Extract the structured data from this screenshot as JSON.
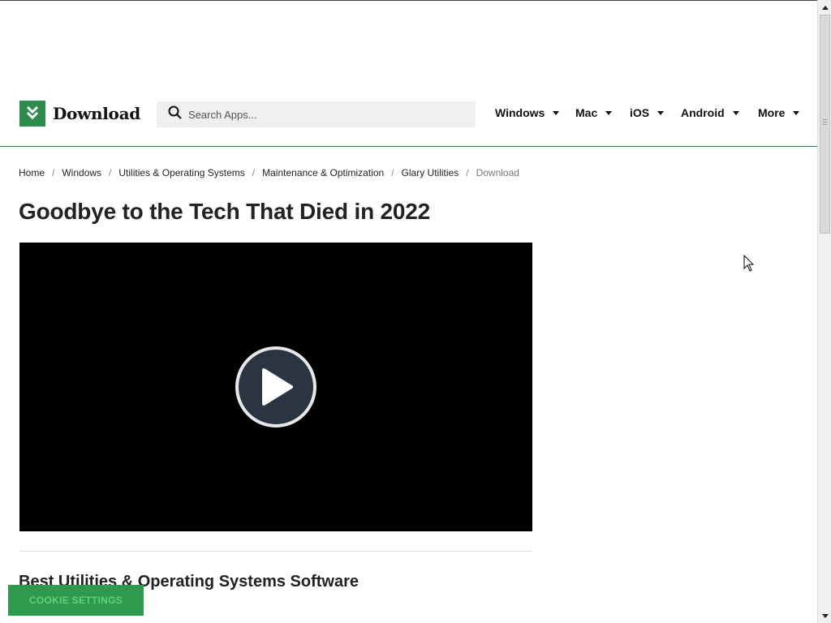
{
  "header": {
    "logo_text": "Download",
    "search_placeholder": "Search Apps...",
    "nav": [
      "Windows",
      "Mac",
      "iOS",
      "Android",
      "More"
    ]
  },
  "breadcrumb": {
    "items": [
      "Home",
      "Windows",
      "Utilities & Operating Systems",
      "Maintenance & Optimization",
      "Glary Utilities"
    ],
    "current": "Download"
  },
  "page_title": "Goodbye to the Tech That Died in 2022",
  "section_title": "Best Utilities & Operating Systems Software",
  "cookie_button": "COOKIE SETTINGS",
  "colors": {
    "brand": "#2e8b4e",
    "cookie_bg": "#2e9a4e",
    "cookie_text": "#5fd07c",
    "play_bg": "#2b3542"
  },
  "icons": {
    "logo": "download-arrow-icon",
    "search": "search-icon",
    "play": "play-icon",
    "dropdown": "caret-down-icon"
  }
}
